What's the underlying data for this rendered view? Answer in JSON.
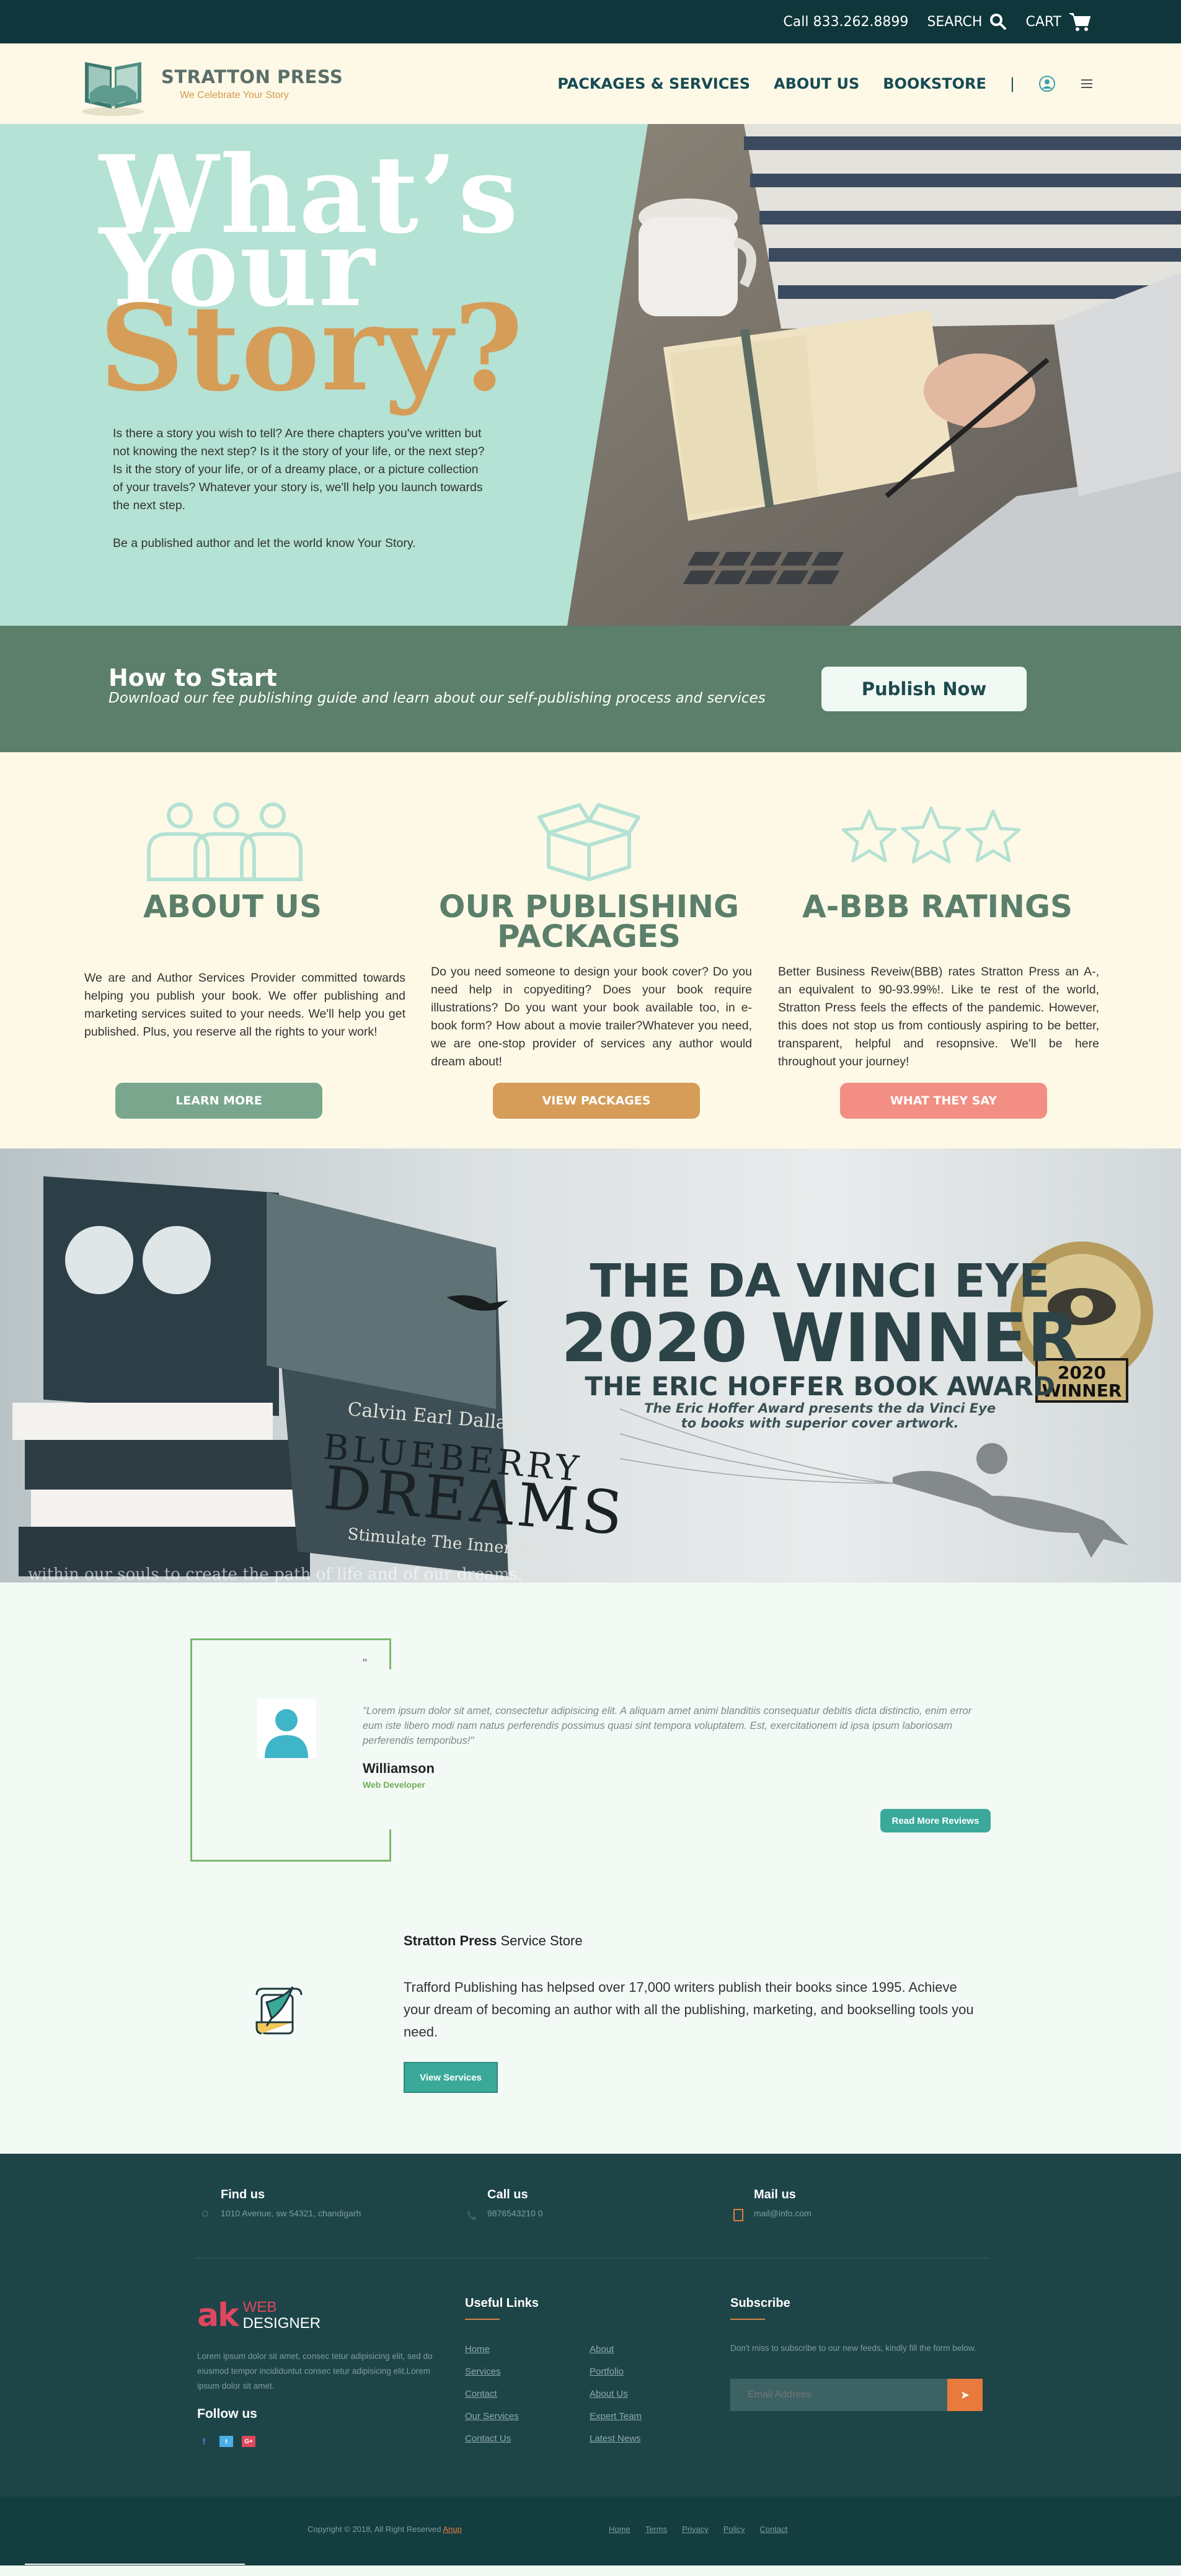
{
  "topbar": {
    "phone": "Call 833.262.8899",
    "search": "SEARCH",
    "cart": "CART"
  },
  "header": {
    "brand": "STRATTON PRESS",
    "tagline": "We Celebrate Your Story",
    "nav": [
      "PACKAGES & SERVICES",
      "ABOUT US",
      "BOOKSTORE"
    ]
  },
  "hero": {
    "line1": "What’s",
    "line2": "Your",
    "line3": "Story?",
    "text": "Is there a story you wish to tell? Are there chapters you've written but not knowing the next step? Is it the story of your life, or the next step? Is it the story of your life, or of a dreamy place, or a picture collection of your travels? Whatever your story is, we'll help you launch towards the next step.",
    "text2": "Be a published author and let the world know Your Story."
  },
  "howto": {
    "title": "How to Start",
    "subtitle": "Download our fee publishing guide and learn about our self-publishing process and services",
    "button": "Publish Now"
  },
  "features": [
    {
      "title": "ABOUT US",
      "text": "We are and Author Services Provider committed towards helping you publish your book. We offer publishing and marketing services suited to your needs. We'll help you get published. Plus, you reserve all the rights to your work!",
      "button": "LEARN MORE",
      "color": "#7aa68e"
    },
    {
      "title": "OUR PUBLISHING PACKAGES",
      "text": "Do you need someone to design your book cover? Do you need help in copyediting? Does your book require illustrations? Do you want your book available too, in e-book form? How about a movie trailer?Whatever you need, we are one-stop provider of services any author would dream about!",
      "button": "VIEW PACKAGES",
      "color": "#d59d58"
    },
    {
      "title": "A-BBB RATINGS",
      "text": "Better Business Reveiw(BBB) rates Stratton Press an A-, an equivalent to 90-93.99%!. Like te rest of the world, Stratton Press feels the effects of the pandemic. However, this does not stop us from contiously aspiring to be better, transparent, helpful and resopnsive. We'll be here throughout your journey!",
      "button": "WHAT THEY SAY",
      "color": "#f28e84"
    }
  ],
  "banner": {
    "line1": "THE DA VINCI EYE",
    "line2": "2020 WINNER",
    "line3": "THE ERIC HOFFER BOOK AWARD",
    "line4": "The Eric Hoffer Award presents the da Vinci Eye",
    "line5": "to books with superior cover artwork.",
    "book_author": "Calvin Earl Dallas",
    "book_title1": "BLUEBERRY",
    "book_title2": "DREAMS",
    "book_subtitle": "Stimulate The Inner You",
    "caption": "within our souls to create the path of life and of our dreams.",
    "seal_year": "2020",
    "seal_label": "WINNER"
  },
  "testimonial": {
    "mark": "\"",
    "quote": "\"Lorem ipsum dolor sit amet, consectetur adipisicing elit. A aliquam amet animi blanditiis consequatur debitis dicta distinctio, enim error eum iste libero modi nam natus perferendis possimus quasi sint tempora voluptatem. Est, exercitationem id ipsa ipsum laboriosam perferendis temporibus!\"",
    "name": "Williamson",
    "role": "Web Developer",
    "button": "Read More Reviews"
  },
  "service": {
    "title_bold": "Stratton Press",
    "title_rest": " Service Store",
    "text": "Trafford Publishing has helpsed over 17,000 writers publish their books since 1995. Achieve your dream of becoming an author with all the publishing, marketing, and bookselling tools you need.",
    "button": "View Services"
  },
  "footer": {
    "find_title": "Find us",
    "find_text": "1010 Avenue, sw 54321, chandigarh",
    "call_title": "Call us",
    "call_text": "9876543210 0",
    "mail_title": "Mail us",
    "mail_text": "mail@info.com",
    "logo_ak": "ak",
    "logo_web": "WEB",
    "logo_designer": "DESIGNER",
    "about": "Lorem ipsum dolor sit amet, consec tetur adipisicing elit, sed do eiusmod tempor incididuntut consec tetur adipisicing elit,Lorem ipsum dolor sit amet.",
    "follow": "Follow us",
    "links_title": "Useful Links",
    "links_col1": [
      "Home",
      "Services",
      "Contact",
      "Our Services",
      "Contact Us"
    ],
    "links_col2": [
      "About",
      "Portfolio",
      "About Us",
      "Expert Team",
      "Latest News"
    ],
    "subscribe_title": "Subscribe",
    "subscribe_text": "Don't miss to subscribe to our new feeds, kindly fill the form below.",
    "email_placeholder": "Email Address"
  },
  "bottom": {
    "copyright": "Copyright © 2018, All Right Reserved ",
    "copyright_link": "Anup",
    "links": [
      "Home",
      "Terms",
      "Privacy",
      "Policy",
      "Contact"
    ]
  }
}
